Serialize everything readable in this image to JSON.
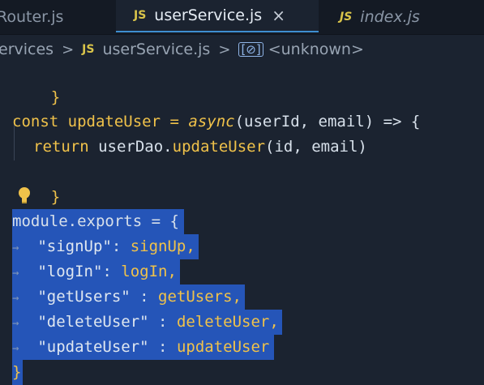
{
  "tabs": [
    {
      "label": "Router.js",
      "icon": "js-file-icon",
      "active": false
    },
    {
      "label": "userService.js",
      "icon": "js-file-icon",
      "active": true,
      "close": "×"
    },
    {
      "label": "index.js",
      "icon": "js-file-icon",
      "active": false
    }
  ],
  "js_badge": "JS",
  "breadcrumb": {
    "folder": "ervices",
    "file": "userService.js",
    "symbol": "<unknown>",
    "separator": ">",
    "symbol_icon": "[⊘]"
  },
  "code": {
    "line1": "}",
    "line3_const": "const",
    "line3_name": "updateUser",
    "line3_eq": " = ",
    "line3_async": "async",
    "line3_params": "(userId, email) => {",
    "line4_return": "return",
    "line4_obj": "userDao",
    "line4_fn": "updateUser",
    "line4_args": "(id, email)",
    "line5": "}",
    "exports_head": "module.exports = {",
    "exports": [
      {
        "key": "\"signUp\"",
        "sep": ": ",
        "val": "signUp,"
      },
      {
        "key": "\"logIn\"",
        "sep": ": ",
        "val": "logIn,"
      },
      {
        "key": "\"getUsers\"",
        "sep": " : ",
        "val": "getUsers,"
      },
      {
        "key": "\"deleteUser\"",
        "sep": " : ",
        "val": "deleteUser,"
      },
      {
        "key": "\"updateUser\"",
        "sep": " : ",
        "val": "updateUser"
      }
    ],
    "close_brace": "}",
    "indent_arrow": "→"
  },
  "colors": {
    "background": "#1b2330",
    "selection": "#2555b8",
    "keyword": "#f0c24a",
    "js_badge": "#d9c44a"
  }
}
